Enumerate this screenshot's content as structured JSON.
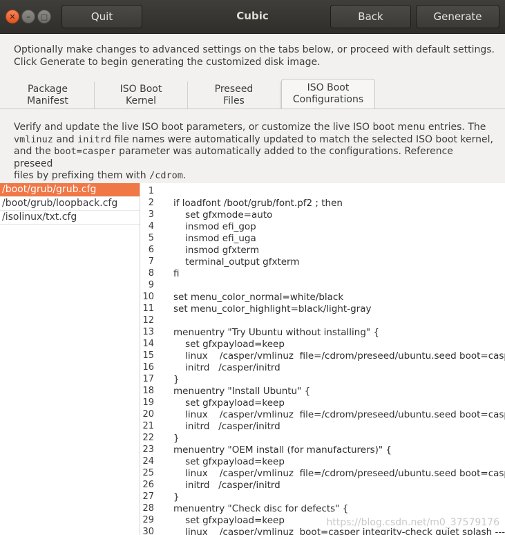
{
  "window": {
    "title": "Cubic",
    "buttons": {
      "quit": "Quit",
      "back": "Back",
      "generate": "Generate"
    },
    "controls": {
      "close_glyph": "✕",
      "min_glyph": "–",
      "max_glyph": "□"
    }
  },
  "intro": {
    "line1": "Optionally make changes to advanced settings on the tabs below, or proceed with default settings.",
    "line2": "Click Generate to begin generating the customized disk image."
  },
  "tabs": [
    {
      "line1": "Package",
      "line2": "Manifest",
      "active": false
    },
    {
      "line1": "ISO Boot",
      "line2": "Kernel",
      "active": false
    },
    {
      "line1": "Preseed",
      "line2": "Files",
      "active": false
    },
    {
      "line1": "ISO Boot",
      "line2": "Configurations",
      "active": true
    }
  ],
  "description": {
    "p1": "Verify and update the live ISO boot parameters, or customize the live ISO boot menu entries. The",
    "mono1": "vmlinuz",
    "and": " and ",
    "mono2": "initrd",
    "p2": " file names were automatically updated to match the selected ISO boot kernel,",
    "p3a": "and the ",
    "mono3": "boot=casper",
    "p3b": " parameter was automatically added to the configurations. Reference preseed",
    "p4a": "files by prefixing them with ",
    "mono4": "/cdrom",
    "p4b": "."
  },
  "files": [
    {
      "name": "/boot/grub/grub.cfg",
      "selected": true
    },
    {
      "name": "/boot/grub/loopback.cfg",
      "selected": false
    },
    {
      "name": "/isolinux/txt.cfg",
      "selected": false
    }
  ],
  "editor": {
    "lines": [
      "",
      "if loadfont /boot/grub/font.pf2 ; then",
      "    set gfxmode=auto",
      "    insmod efi_gop",
      "    insmod efi_uga",
      "    insmod gfxterm",
      "    terminal_output gfxterm",
      "fi",
      "",
      "set menu_color_normal=white/black",
      "set menu_color_highlight=black/light-gray",
      "",
      "menuentry \"Try Ubuntu without installing\" {",
      "    set gfxpayload=keep",
      "    linux    /casper/vmlinuz  file=/cdrom/preseed/ubuntu.seed boot=casper quiet splash ---",
      "    initrd   /casper/initrd",
      "}",
      "menuentry \"Install Ubuntu\" {",
      "    set gfxpayload=keep",
      "    linux    /casper/vmlinuz  file=/cdrom/preseed/ubuntu.seed boot=casper only-ubiquity quiet splash ---",
      "    initrd   /casper/initrd",
      "}",
      "menuentry \"OEM install (for manufacturers)\" {",
      "    set gfxpayload=keep",
      "    linux    /casper/vmlinuz  file=/cdrom/preseed/ubuntu.seed boot=casper only-ubiquity quiet splash oem-config/enable=true ---",
      "    initrd   /casper/initrd",
      "}",
      "menuentry \"Check disc for defects\" {",
      "    set gfxpayload=keep",
      "    linux    /casper/vmlinuz  boot=casper integrity-check quiet splash ---"
    ],
    "watermark": "https://blog.csdn.net/m0_37579176"
  }
}
